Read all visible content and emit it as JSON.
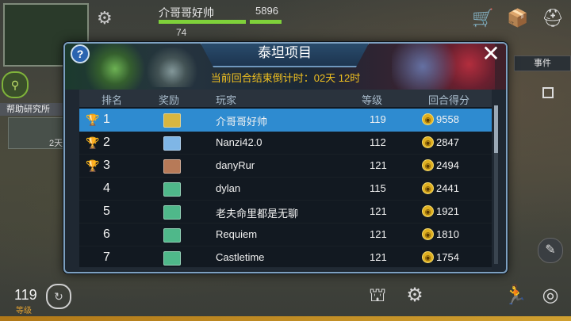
{
  "hud": {
    "player_name": "介哥哥好帅",
    "power": "5896",
    "sub_value": "74",
    "event_tab": "事件",
    "research_tab": "帮助研究所",
    "research_time": "2天",
    "player_level": "119",
    "player_level_label": "等级"
  },
  "modal": {
    "title": "泰坦项目",
    "countdown": "当前回合结束倒计时：02天 12时",
    "help": "?",
    "close": "✕",
    "columns": [
      "排名",
      "奖励",
      "玩家",
      "等级",
      "回合得分"
    ],
    "rows": [
      {
        "rank": "1",
        "player": "介哥哥好帅",
        "level": "119",
        "score": "9558",
        "trophy": "gold",
        "reward": "gold"
      },
      {
        "rank": "2",
        "player": "Nanzi42.0",
        "level": "112",
        "score": "2847",
        "trophy": "silver",
        "reward": "blue"
      },
      {
        "rank": "3",
        "player": "danyRur",
        "level": "121",
        "score": "2494",
        "trophy": "bronze",
        "reward": "brown"
      },
      {
        "rank": "4",
        "player": "dylan",
        "level": "115",
        "score": "2441",
        "trophy": "",
        "reward": "green"
      },
      {
        "rank": "5",
        "player": "老夫命里都是无聊",
        "level": "121",
        "score": "1921",
        "trophy": "",
        "reward": "green"
      },
      {
        "rank": "6",
        "player": "Requiem",
        "level": "121",
        "score": "1810",
        "trophy": "",
        "reward": "green"
      },
      {
        "rank": "7",
        "player": "Castletime",
        "level": "121",
        "score": "1754",
        "trophy": "",
        "reward": "green"
      }
    ]
  },
  "colors": {
    "highlight": "#2e8bd0",
    "countdown": "#f0c020",
    "gold": "#d9a92a",
    "silver": "#c8ccd0",
    "bronze": "#b8773a",
    "reward_gold": "#d7b640",
    "reward_blue": "#7fb6e6",
    "reward_brown": "#b77a58",
    "reward_green": "#4fb88a"
  },
  "icons": {
    "settings": "gear-icon",
    "shop": "cart-icon",
    "inventory": "box-icon",
    "profile": "helmet-icon",
    "score": "coin-icon"
  }
}
